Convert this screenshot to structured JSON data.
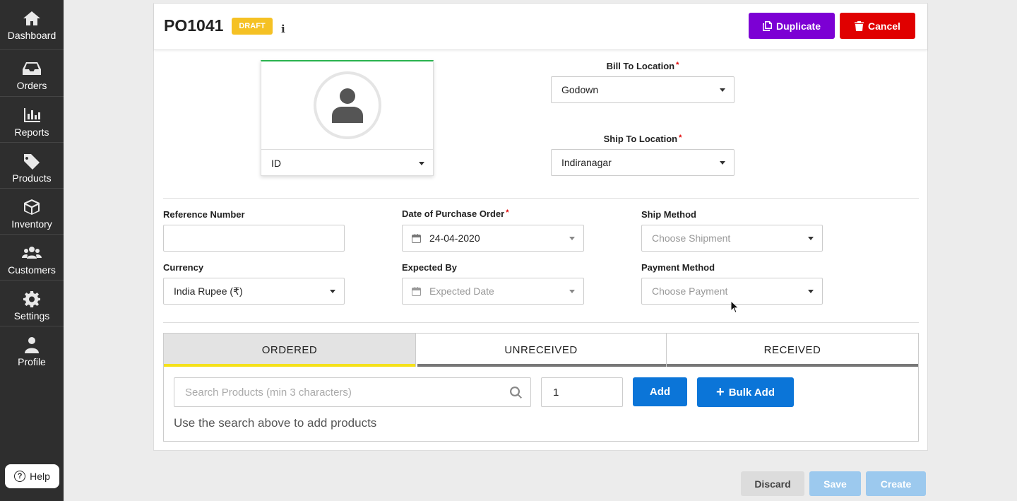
{
  "sidebar": {
    "items": [
      {
        "label": "Dashboard",
        "icon": "home-icon"
      },
      {
        "label": "Orders",
        "icon": "inbox-icon"
      },
      {
        "label": "Reports",
        "icon": "bar-chart-icon"
      },
      {
        "label": "Products",
        "icon": "tag-icon"
      },
      {
        "label": "Inventory",
        "icon": "cube-icon"
      },
      {
        "label": "Customers",
        "icon": "users-icon"
      },
      {
        "label": "Settings",
        "icon": "gear-icon"
      },
      {
        "label": "Profile",
        "icon": "user-icon"
      }
    ],
    "help_label": "Help"
  },
  "header": {
    "po_number": "PO1041",
    "status": "DRAFT",
    "info_glyph": "i",
    "duplicate_label": "Duplicate",
    "cancel_label": "Cancel"
  },
  "vendor": {
    "select_value": "ID"
  },
  "locations": {
    "bill_to_label": "Bill To Location",
    "bill_to_value": "Godown",
    "ship_to_label": "Ship To Location",
    "ship_to_value": "Indiranagar"
  },
  "form": {
    "reference_label": "Reference Number",
    "reference_value": "",
    "po_date_label": "Date of Purchase Order",
    "po_date_value": "24-04-2020",
    "ship_method_label": "Ship Method",
    "ship_method_placeholder": "Choose Shipment",
    "currency_label": "Currency",
    "currency_value": "India Rupee (₹)",
    "expected_label": "Expected By",
    "expected_placeholder": "Expected Date",
    "payment_label": "Payment Method",
    "payment_placeholder": "Choose Payment"
  },
  "tabs": [
    {
      "label": "ORDERED",
      "active": true
    },
    {
      "label": "UNRECEIVED",
      "active": false
    },
    {
      "label": "RECEIVED",
      "active": false
    }
  ],
  "products": {
    "search_placeholder": "Search Products (min 3 characters)",
    "quantity": "1",
    "add_label": "Add",
    "bulk_add_label": "Bulk Add",
    "hint": "Use the search above to add products"
  },
  "footer": {
    "discard_label": "Discard",
    "save_label": "Save",
    "create_label": "Create"
  },
  "colors": {
    "sidebar_bg": "#2e2e2e",
    "duplicate": "#7c00d4",
    "cancel": "#e00000",
    "primary": "#0b75d8",
    "draft": "#f5c124",
    "active_tab": "#f5e11a"
  }
}
